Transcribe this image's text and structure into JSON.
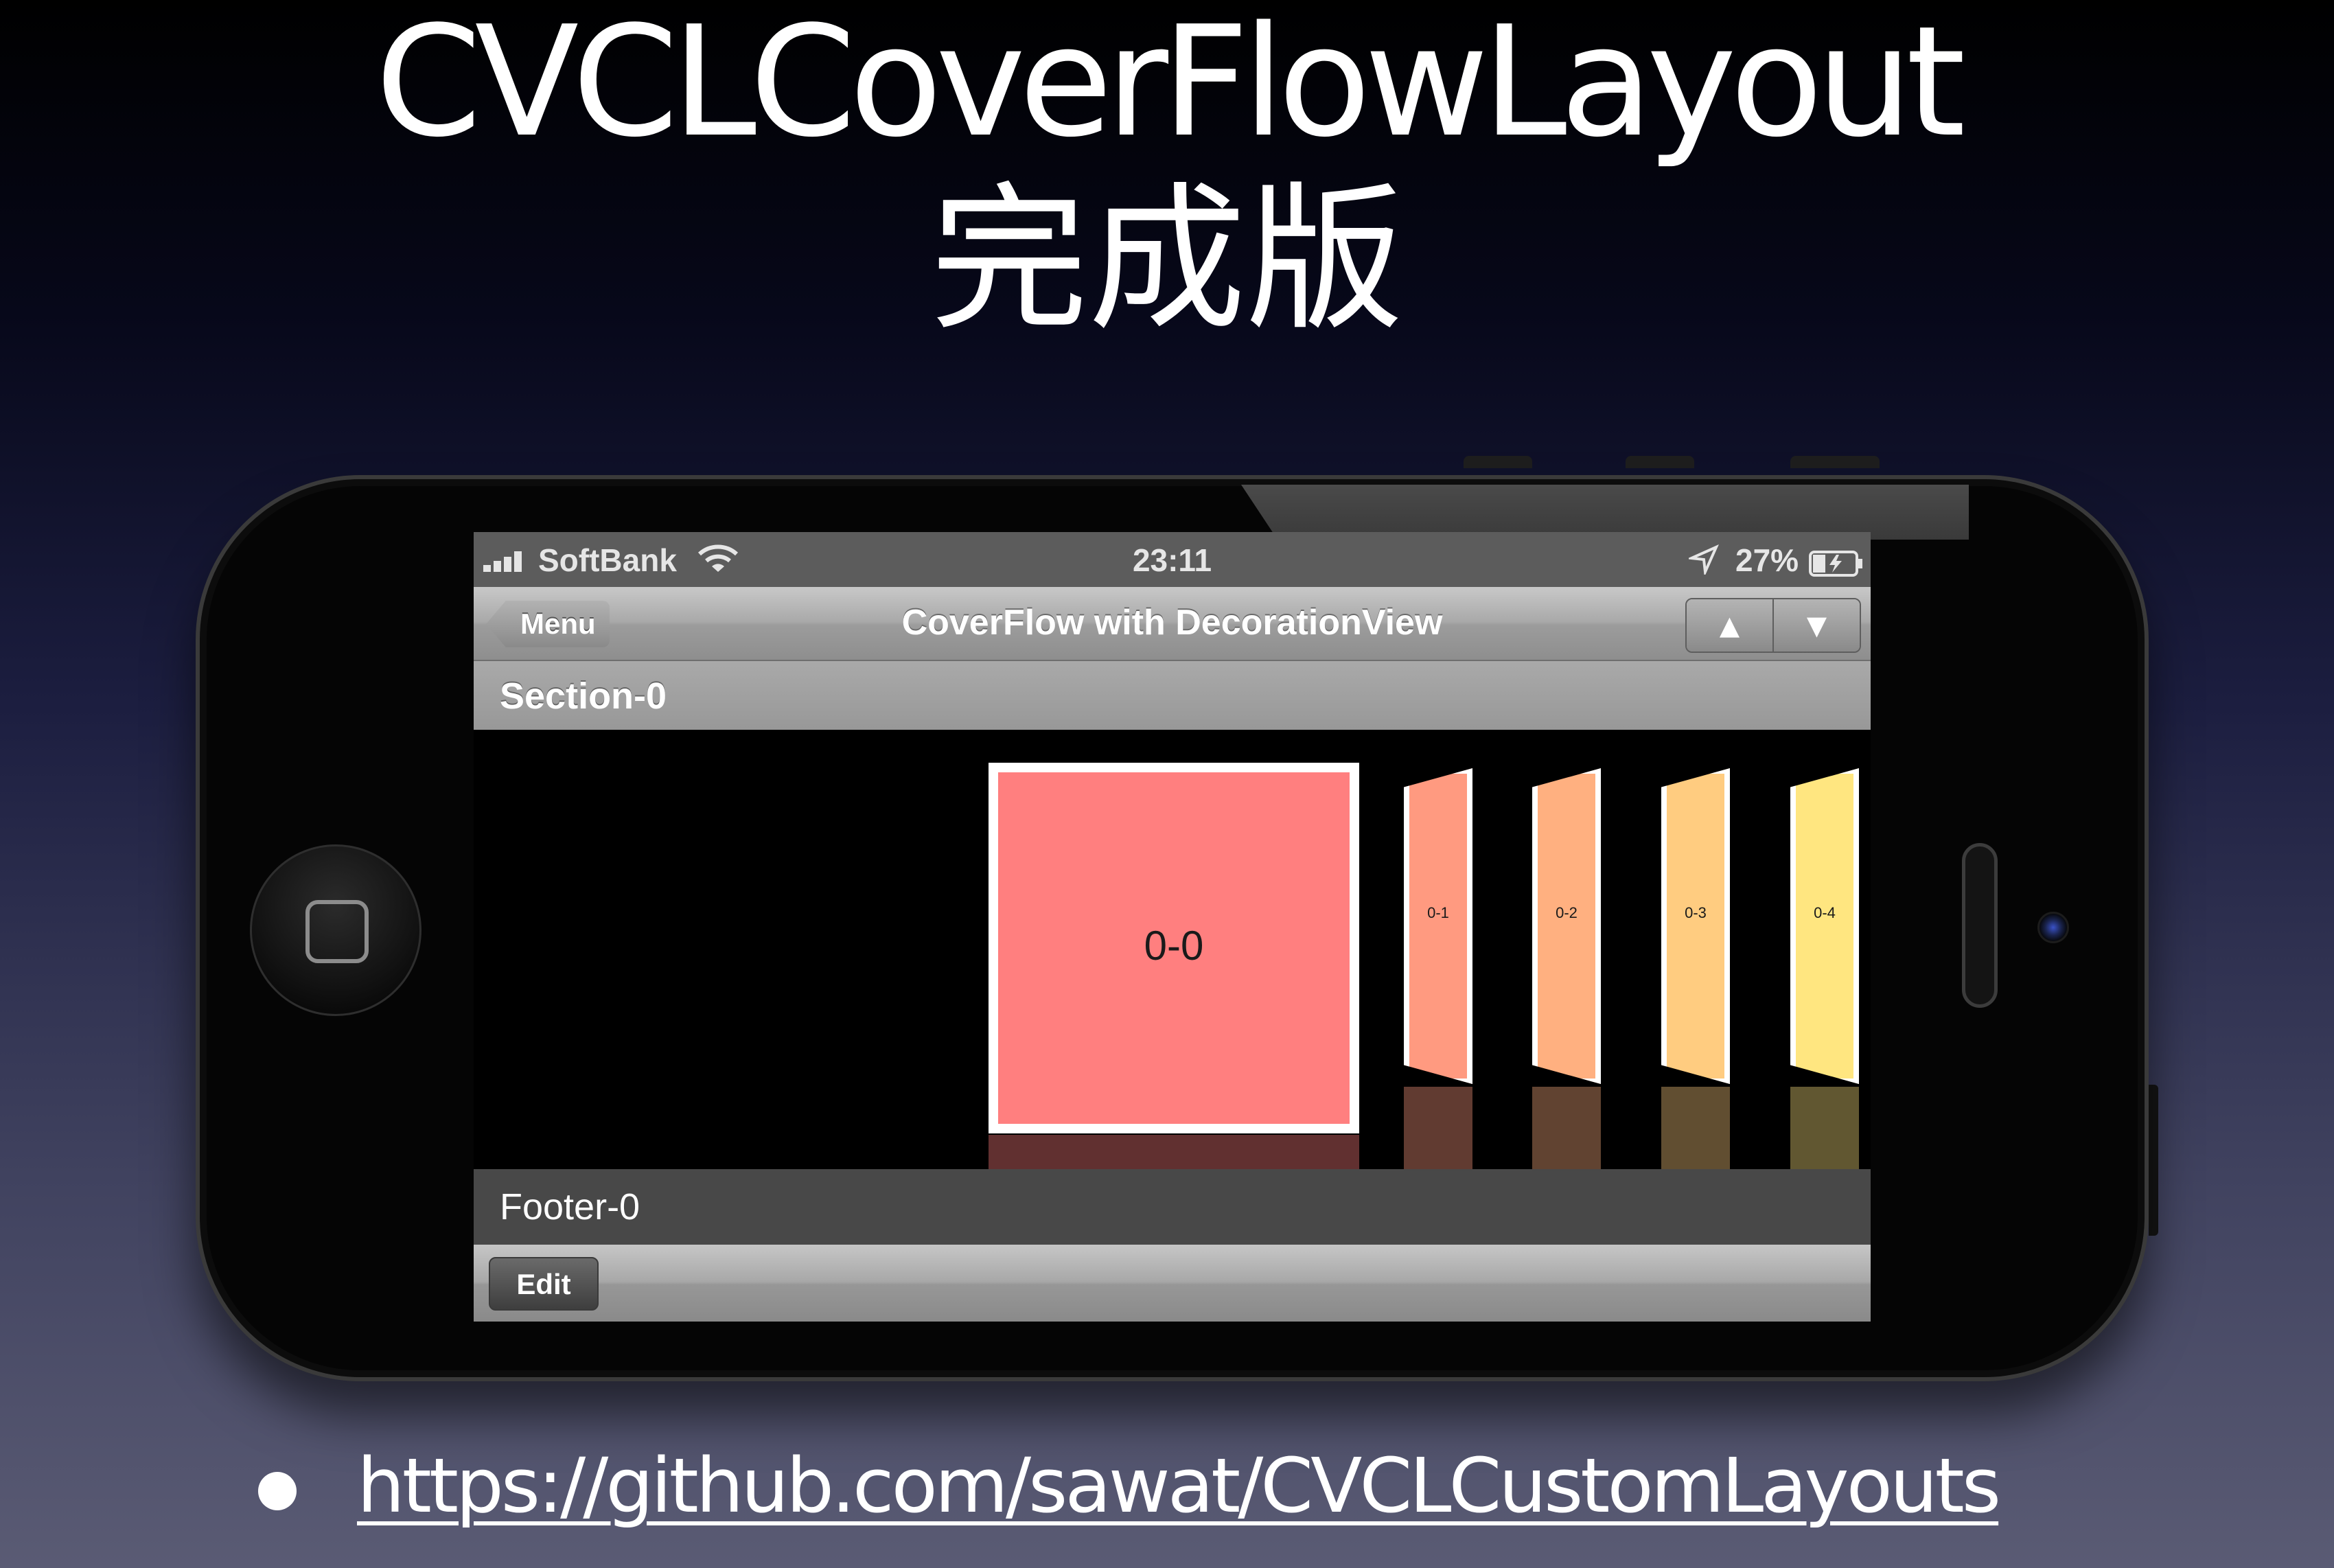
{
  "slide": {
    "title_line1": "CVCLCoverFlowLayout",
    "title_line2": "完成版",
    "link": "https://github.com/sawat/CVCLCustomLayouts"
  },
  "status_bar": {
    "carrier": "SoftBank",
    "time": "23:11",
    "battery": "27%",
    "icons": [
      "signal-bars-icon",
      "wifi-icon",
      "location-arrow-icon",
      "battery-charging-icon"
    ]
  },
  "nav_bar": {
    "back_label": "Menu",
    "title": "CoverFlow with DecorationView",
    "segment_up": "▲",
    "segment_down": "▼"
  },
  "collection": {
    "section_header": "Section-0",
    "items": [
      {
        "label": "0-0",
        "color": "#ff7f7f"
      },
      {
        "label": "0-1",
        "color": "#ff9a80"
      },
      {
        "label": "0-2",
        "color": "#ffb080"
      },
      {
        "label": "0-3",
        "color": "#ffcc80"
      },
      {
        "label": "0-4",
        "color": "#ffe680"
      }
    ],
    "footer": "Footer-0"
  },
  "toolbar": {
    "edit_label": "Edit"
  }
}
